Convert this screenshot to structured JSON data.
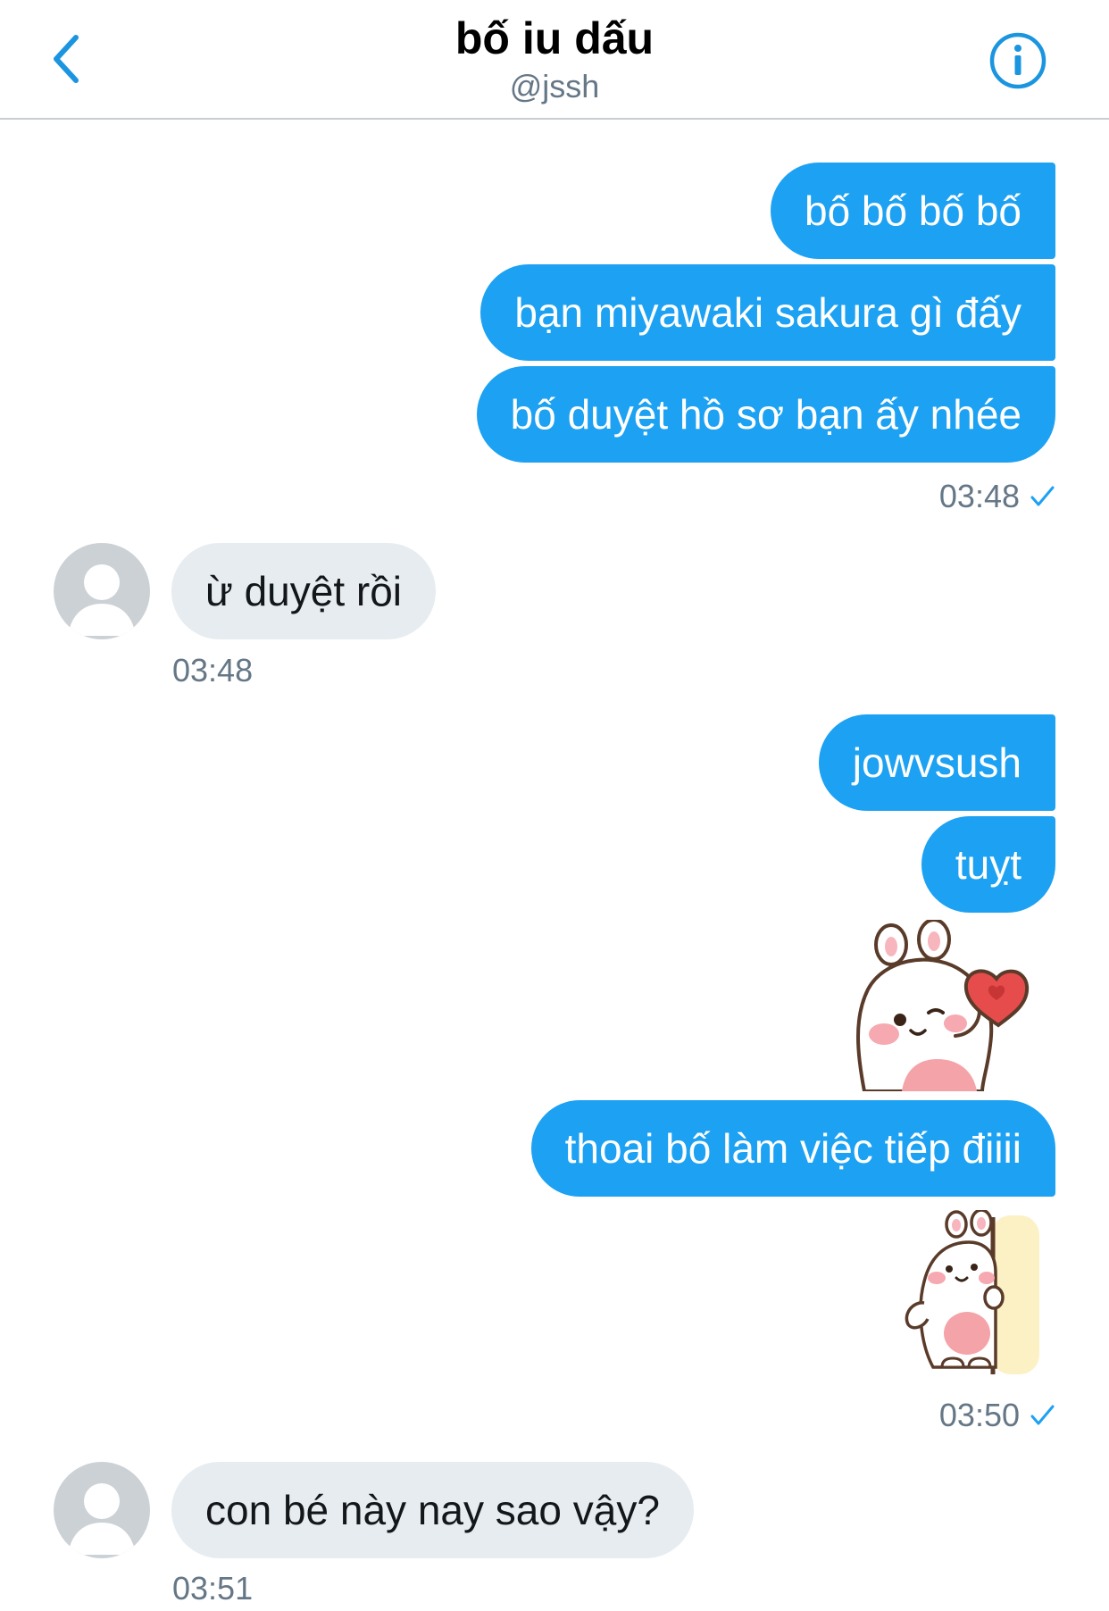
{
  "header": {
    "title": "bố iu dấu",
    "handle": "@jssh",
    "back_icon": "chevron-left-icon",
    "info_icon": "info-icon"
  },
  "colors": {
    "accent": "#1da1f2",
    "incoming_bubble": "#e6ecf0",
    "muted_text": "#657786"
  },
  "messages": [
    {
      "dir": "out",
      "text": "bố bố bố bố"
    },
    {
      "dir": "out",
      "text": "bạn miyawaki sakura gì đấy"
    },
    {
      "dir": "out",
      "text": "bố duyệt hồ sơ bạn ấy nhée"
    },
    {
      "dir": "out",
      "time": "03:48",
      "status": "sent-check-icon"
    },
    {
      "dir": "in",
      "text": "ừ duyệt rồi",
      "time": "03:48"
    },
    {
      "dir": "out",
      "text": "jowvsush"
    },
    {
      "dir": "out",
      "text": "tuỵt"
    },
    {
      "dir": "out",
      "sticker": "bunny-heart-sticker"
    },
    {
      "dir": "out",
      "text": "thoai bố làm việc tiếp điiii"
    },
    {
      "dir": "out",
      "sticker": "bunny-peek-sticker"
    },
    {
      "dir": "out",
      "time": "03:50",
      "status": "sent-check-icon"
    },
    {
      "dir": "in",
      "text": "con bé này nay sao vậy?",
      "time": "03:51"
    }
  ]
}
